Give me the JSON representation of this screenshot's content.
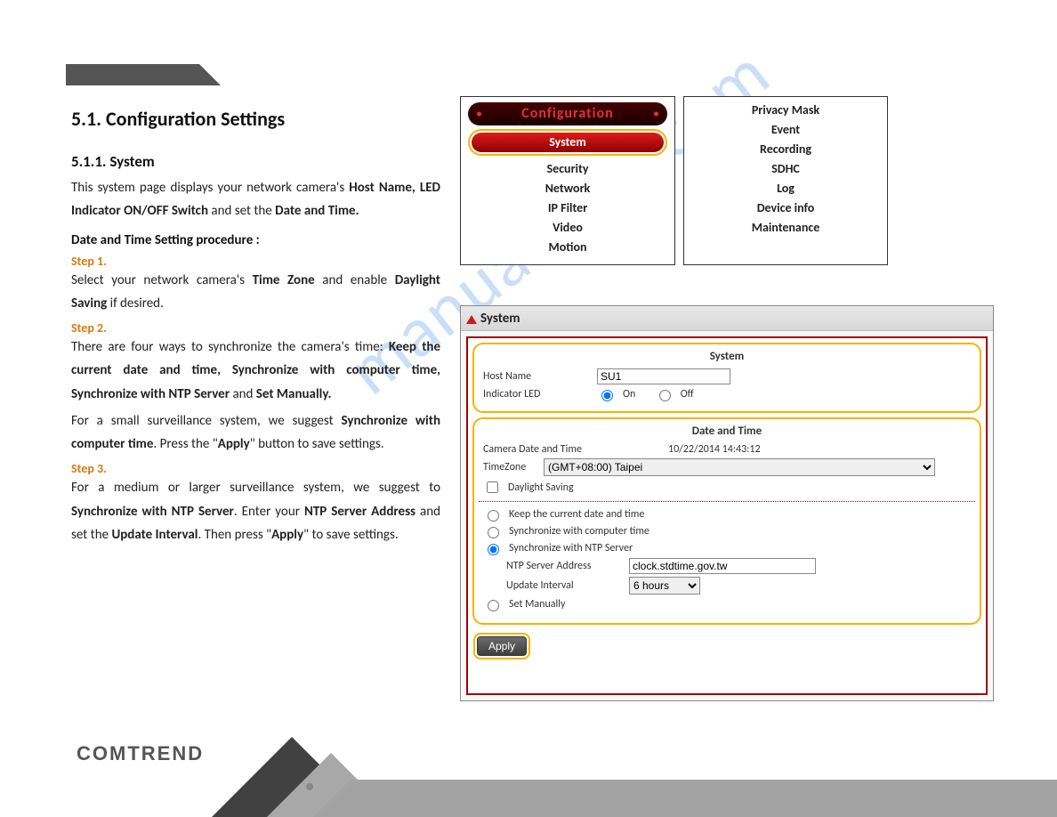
{
  "watermark": "manualslive.com",
  "heading": "5.1. Configuration Settings",
  "sub1": "5.1.1. System",
  "intro_parts": [
    "This system page displays your network camera's ",
    "Host Name, LED Indicator ON/OFF Switch",
    " and set the ",
    "Date and Time."
  ],
  "proc_hd": "Date and Time Setting procedure :",
  "steps": {
    "s1": "Step 1.",
    "s1_parts": [
      "Select your network camera's ",
      "Time Zone",
      " and enable ",
      "Daylight Saving",
      " if desired."
    ],
    "s2": "Step 2.",
    "s2a_parts": [
      "There are four ways to synchronize the camera's time: ",
      "Keep the current date and time, Synchronize with computer time, Synchronize with NTP Server",
      " and ",
      "Set Manually."
    ],
    "s2b_parts": [
      "For a small surveillance system, we suggest ",
      "Synchronize with computer time",
      ". Press the \"",
      "Apply",
      "\" button to save settings."
    ],
    "s3": "Step 3.",
    "s3_parts": [
      "For a medium or larger surveillance system, we suggest to ",
      "Synchronize with NTP Server",
      ". Enter your ",
      "NTP Server Address",
      " and set the ",
      "Update Interval",
      ". Then press \"",
      "Apply",
      "\" to save settings."
    ]
  },
  "menu1": {
    "header": "Configuration",
    "active": "System",
    "items": [
      "Security",
      "Network",
      "IP Filter",
      "Video",
      "Motion"
    ]
  },
  "menu2": {
    "items": [
      "Privacy Mask",
      "Event",
      "Recording",
      "SDHC",
      "Log",
      "Device info",
      "Maintenance"
    ]
  },
  "panel": {
    "title": "System",
    "system_group": {
      "title": "System",
      "hostname_label": "Host Name",
      "hostname_value": "SU1",
      "led_label": "Indicator LED",
      "led_on": "On",
      "led_off": "Off",
      "led_selected": "on"
    },
    "dt_group": {
      "title": "Date and Time",
      "cam_dt_label": "Camera Date and Time",
      "cam_dt_value": "10/22/2014 14:43:12",
      "tz_label": "TimeZone",
      "tz_value": "(GMT+08:00) Taipei",
      "daylight_label": "Daylight Saving",
      "opts": {
        "keep": "Keep the current date and time",
        "comp": "Synchronize with computer time",
        "ntp": "Synchronize with NTP Server",
        "man": "Set Manually"
      },
      "selected_opt": "ntp",
      "ntp_addr_label": "NTP Server Address",
      "ntp_addr_value": "clock.stdtime.gov.tw",
      "upd_label": "Update Interval",
      "upd_value": "6 hours"
    },
    "apply_label": "Apply"
  },
  "brand": "COMTREND"
}
